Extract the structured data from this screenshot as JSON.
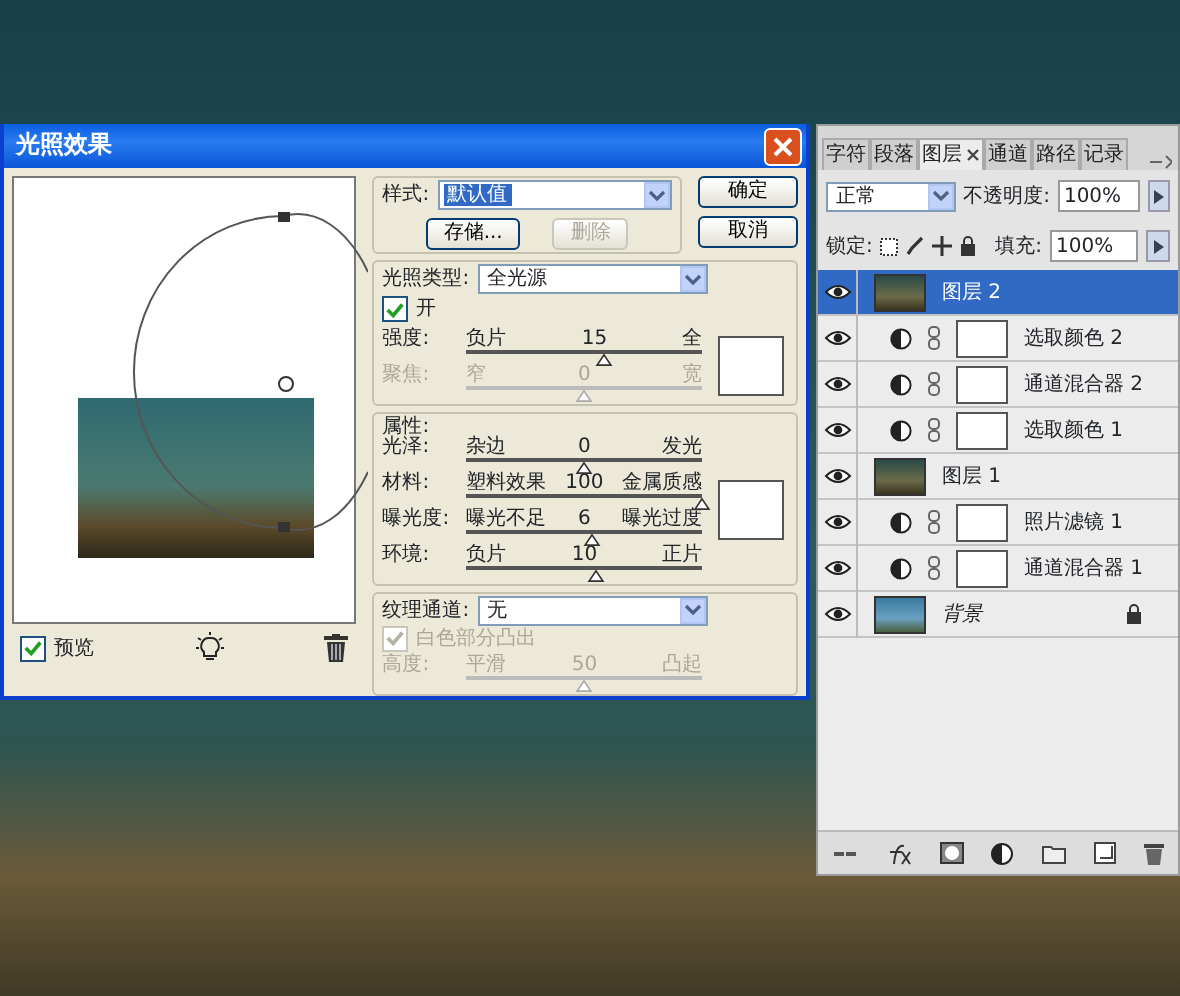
{
  "dialog": {
    "title": "光照效果",
    "preview": {
      "label": "预览",
      "checked": true
    },
    "style": {
      "label": "样式:",
      "value": "默认值"
    },
    "buttons": [
      {
        "label": "存储...",
        "disabled": false
      },
      {
        "label": "删除",
        "disabled": true
      }
    ],
    "actions": [
      "确定",
      "取消"
    ],
    "light_type": {
      "label": "光照类型:",
      "value": "全光源",
      "on": {
        "label": "开",
        "checked": true
      },
      "sliders": [
        {
          "label": "强度:",
          "left": "负片",
          "value": "15",
          "right": "全",
          "level": 0.58,
          "disabled": false
        },
        {
          "label": "聚焦:",
          "left": "窄",
          "value": "0",
          "right": "宽",
          "level": 0.5,
          "disabled": true
        }
      ]
    },
    "properties": {
      "label": "属性:",
      "sliders": [
        {
          "label": "光泽:",
          "left": "杂边",
          "value": "0",
          "right": "发光",
          "level": 0.5,
          "disabled": false
        },
        {
          "label": "材料:",
          "left": "塑料效果",
          "value": "100",
          "right": "金属质感",
          "level": 1,
          "disabled": false
        },
        {
          "label": "曝光度:",
          "left": "曝光不足",
          "value": "6",
          "right": "曝光过度",
          "level": 0.53,
          "disabled": false
        },
        {
          "label": "环境:",
          "left": "负片",
          "value": "10",
          "right": "正片",
          "level": 0.55,
          "disabled": false
        }
      ]
    },
    "texture": {
      "label": "纹理通道:",
      "value": "无",
      "white_high": {
        "label": "白色部分凸出",
        "checked": true,
        "disabled": true
      },
      "sliders": [
        {
          "label": "高度:",
          "left": "平滑",
          "value": "50",
          "right": "凸起",
          "level": 0.5,
          "disabled": true
        }
      ]
    }
  },
  "layers_panel": {
    "tabs": [
      {
        "label": "字符",
        "selected": false
      },
      {
        "label": "段落",
        "selected": false
      },
      {
        "label": "图层",
        "selected": true
      },
      {
        "label": "通道",
        "selected": false
      },
      {
        "label": "路径",
        "selected": false
      },
      {
        "label": "记录",
        "selected": false
      }
    ],
    "blend_mode": "正常",
    "opacity": {
      "label": "不透明度:",
      "value": "100%"
    },
    "lock_label": "锁定:",
    "fill": {
      "label": "填充:",
      "value": "100%"
    },
    "layers": [
      {
        "name": "图层 2",
        "kind": "pixel",
        "selected": true
      },
      {
        "name": "选取颜色 2",
        "kind": "adjustment",
        "selected": false
      },
      {
        "name": "通道混合器 2",
        "kind": "adjustment",
        "selected": false
      },
      {
        "name": "选取颜色 1",
        "kind": "adjustment",
        "selected": false
      },
      {
        "name": "图层 1",
        "kind": "pixel",
        "selected": false
      },
      {
        "name": "照片滤镜 1",
        "kind": "adjustment",
        "selected": false
      },
      {
        "name": "通道混合器 1",
        "kind": "adjustment",
        "selected": false
      },
      {
        "name": "背景",
        "kind": "background",
        "selected": false
      }
    ]
  }
}
